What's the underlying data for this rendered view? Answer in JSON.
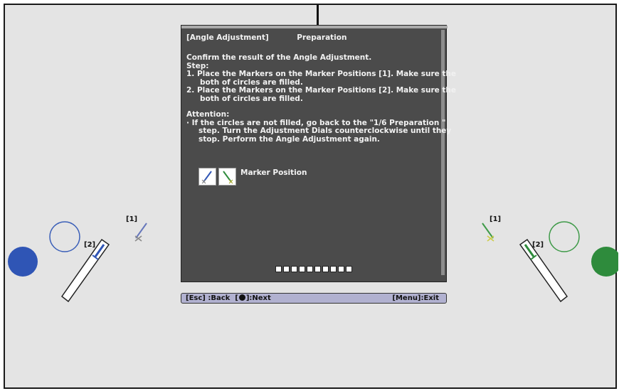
{
  "dialog": {
    "title": "[Angle Adjustment]",
    "subtitle": "Preparation",
    "lines": [
      "Confirm the result of the Angle Adjustment.",
      "Step:",
      "1. Place the Markers on the Marker Positions [1]. Make sure the",
      "both of circles are filled.",
      "2. Place the Markers on the Marker Positions [2]. Make sure the",
      "both of circles are filled."
    ],
    "attention_title": "Attention:",
    "attention_lines": [
      "· If the circles are not filled, go back to the \"1/6 Preparation \"",
      "step. Turn the Adjustment Dials counterclockwise until they",
      "stop. Perform the Angle Adjustment again."
    ],
    "marker_label": "Marker Position",
    "progress_steps": 10
  },
  "statusbar": {
    "back": "[Esc] :Back",
    "next_prefix": "[",
    "next_suffix": "]:Next",
    "exit": "[Menu]:Exit"
  },
  "labels": {
    "left_1": "[1]",
    "left_2": "[2]",
    "right_1": "[1]",
    "right_2": "[2]"
  },
  "colors": {
    "blue": "#2f55b5",
    "green": "#2e8b3c",
    "panel": "#4b4b4b",
    "statusbar": "#b1b1d0"
  },
  "icons": [
    "marker-blue-icon",
    "marker-green-icon",
    "enter-dial-icon"
  ]
}
